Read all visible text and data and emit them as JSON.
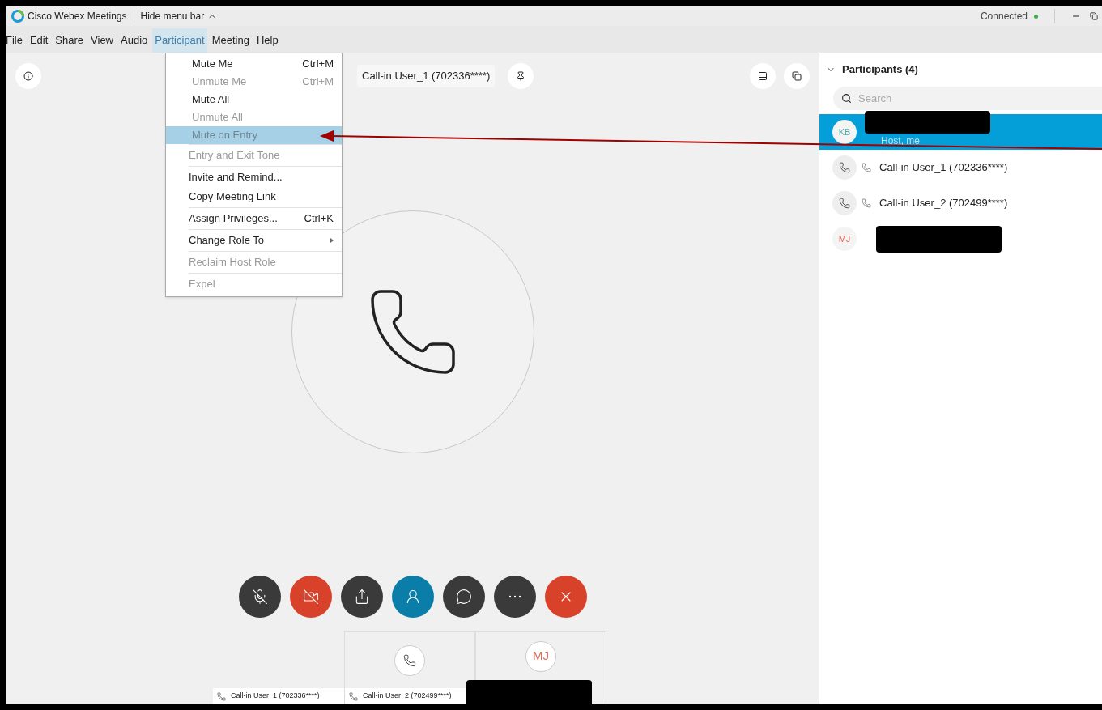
{
  "title_bar": {
    "app_title": "Cisco Webex Meetings",
    "hide_menu": "Hide menu bar",
    "status": "Connected"
  },
  "menu_bar": [
    {
      "label": "File",
      "selected": false
    },
    {
      "label": "Edit",
      "selected": false
    },
    {
      "label": "Share",
      "selected": false
    },
    {
      "label": "View",
      "selected": false
    },
    {
      "label": "Audio",
      "selected": false
    },
    {
      "label": "Participant",
      "selected": true
    },
    {
      "label": "Meeting",
      "selected": false
    },
    {
      "label": "Help",
      "selected": false
    }
  ],
  "participant_menu": [
    [
      {
        "label": "Mute Me",
        "shortcut": "Ctrl+M",
        "disabled": false,
        "selected": false
      },
      {
        "label": "Unmute Me",
        "shortcut": "Ctrl+M",
        "disabled": true,
        "selected": false
      },
      {
        "label": "Mute All",
        "disabled": false,
        "selected": false
      },
      {
        "label": "Unmute All",
        "disabled": true,
        "selected": false
      },
      {
        "label": "Mute on Entry",
        "disabled": true,
        "selected": true
      }
    ],
    [
      {
        "label": "Entry and Exit Tone",
        "disabled": true,
        "selected": false
      }
    ],
    [
      {
        "label": "Invite and Remind...",
        "disabled": false,
        "selected": false
      },
      {
        "label": "Copy Meeting Link",
        "disabled": false,
        "selected": false
      }
    ],
    [
      {
        "label": "Assign Privileges...",
        "shortcut": "Ctrl+K",
        "disabled": false,
        "selected": false
      }
    ],
    [
      {
        "label": "Change Role To",
        "submenu": true,
        "disabled": false,
        "selected": false
      }
    ],
    [
      {
        "label": "Reclaim Host Role",
        "disabled": true,
        "selected": false
      }
    ],
    [
      {
        "label": "Expel",
        "disabled": true,
        "selected": false
      }
    ]
  ],
  "stage": {
    "active_speaker": "Call-in User_1 (702336****)"
  },
  "controls": [
    {
      "kind": "mute"
    },
    {
      "kind": "video"
    },
    {
      "kind": "share"
    },
    {
      "kind": "participants"
    },
    {
      "kind": "chat"
    },
    {
      "kind": "more"
    },
    {
      "kind": "end"
    }
  ],
  "thumbnails": [
    {
      "kind": "label_only",
      "label": "Call-in User_1 (702336****)"
    },
    {
      "kind": "phone",
      "label": "Call-in User_2 (702499****)"
    },
    {
      "kind": "initials",
      "initials": "MJ",
      "redacted": true
    }
  ],
  "panel": {
    "title": "Participants (4)",
    "expanded": true,
    "search": {
      "placeholder": "Search"
    },
    "participants": [
      {
        "kind": "initials",
        "initials": "KB",
        "color": "#4fb3a9",
        "redacted": true,
        "subtitle": "Host, me",
        "selected": true
      },
      {
        "kind": "phone",
        "name": "Call-in User_1 (702336****)",
        "selected": false
      },
      {
        "kind": "phone",
        "name": "Call-in User_2 (702499****)",
        "selected": false
      },
      {
        "kind": "initials",
        "initials": "MJ",
        "color": "#e0645a",
        "redacted": true,
        "selected": false
      }
    ]
  }
}
